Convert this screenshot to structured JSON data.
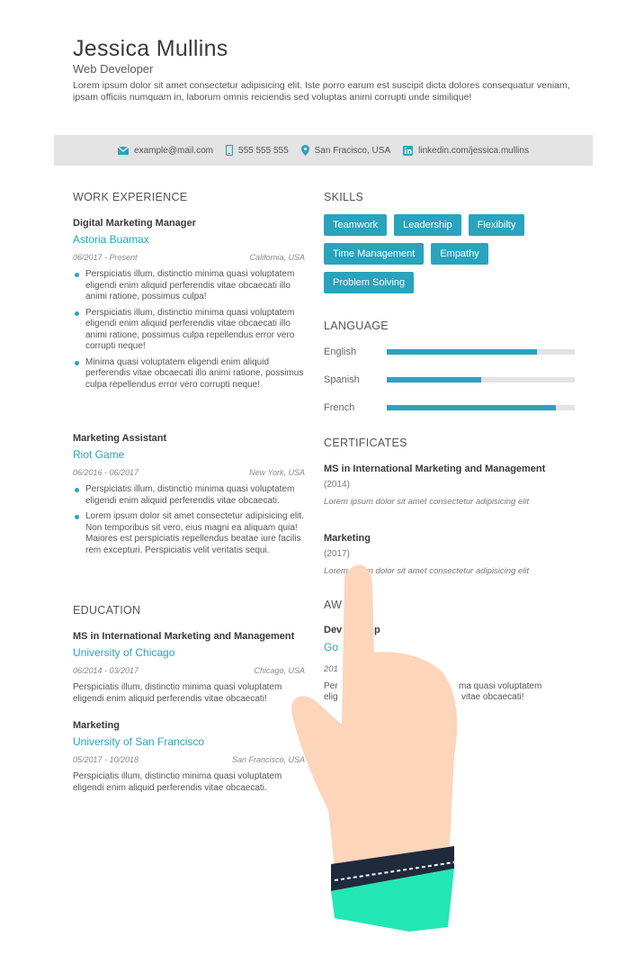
{
  "header": {
    "name": "Jessica Mullins",
    "role": "Web Developer",
    "summary": "Lorem ipsum dolor sit amet consectetur adipisicing elit. Iste porro earum est suscipit dicta dolores consequatur veniam, ipsam officiis numquam in, laborum omnis reiciendis sed voluptas animi corrupti unde similique!"
  },
  "contact": {
    "email": "example@mail.com",
    "phone": "555 555 555",
    "location": "San Fracisco, USA",
    "linkedin": "linkedin.com/jessica.mullins",
    "icons": [
      "envelope-icon",
      "phone-icon",
      "location-pin-icon",
      "linkedin-icon"
    ]
  },
  "work": {
    "heading": "WORK EXPERIENCE",
    "jobs": [
      {
        "title": "Digital Marketing Manager",
        "company": "Astoria Buamax",
        "dates": "06/2017 - Present",
        "location": "California, USA",
        "bullets": [
          "Perspiciatis illum, distinctio minima quasi voluptatem eligendi enim aliquid perferendis vitae obcaecati illo animi ratione, possimus culpa!",
          "Perspiciatis illum, distinctio minima quasi voluptatem eligendi enim aliquid perferendis vitae obcaecati illo animi ratione, possimus culpa repellendus error vero corrupti neque!",
          "Minima quasi voluptatem eligendi enim aliquid perferendis vitae obcaecati illo animi ratione, possimus culpa repellendus error vero corrupti neque!"
        ]
      },
      {
        "title": "Marketing Assistant",
        "company": "Riot Game",
        "dates": "06/2016 - 06/2017",
        "location": "New York, USA",
        "bullets": [
          "Perspiciatis illum, distinctio minima quasi voluptatem eligendi enim aliquid perferendis vitae obcaecati.",
          "Lorem ipsum dolor sit amet consectetur adipisicing elit. Non temporibus sit vero, eius magni ea aliquam quia! Maiores est perspiciatis repellendus beatae iure facilis rem excepturi. Perspiciatis velit veritatis sequi."
        ]
      }
    ]
  },
  "education": {
    "heading": "EDUCATION",
    "items": [
      {
        "degree": "MS in International Marketing and Management",
        "school": "University of Chicago",
        "dates": "06/2014 - 03/2017",
        "location": "Chicago, USA",
        "desc": "Perspiciatis illum, distinctio minima quasi voluptatem eligendi enim aliquid perferendis vitae obcaecati!"
      },
      {
        "degree": "Marketing",
        "school": "University of San Francisco",
        "dates": "05/2017 - 10/2018",
        "location": "San Francisco, USA",
        "desc": "Perspiciatis illum, distinctio minima quasi voluptatem eligendi enim aliquid perferendis vitae obcaecati."
      }
    ]
  },
  "skills": {
    "heading": "SKILLS",
    "items": [
      "Teamwork",
      "Leadership",
      "Flexibilty",
      "Time Management",
      "Empathy",
      "Problem Solving"
    ],
    "accent_color": "#2aa3bd"
  },
  "language": {
    "heading": "LANGUAGE",
    "items": [
      {
        "name": "English",
        "level": 0.8
      },
      {
        "name": "Spanish",
        "level": 0.5
      },
      {
        "name": "French",
        "level": 0.9
      }
    ]
  },
  "certificates": {
    "heading": "CERTIFICATES",
    "items": [
      {
        "title": "MS in International Marketing and Management",
        "year": "(2014)",
        "desc": "Lorem ipsum dolor sit amet consectetur adipisicing elit"
      },
      {
        "title": "Marketing",
        "year": "(2017)",
        "desc": "Lorem ipsum dolor sit amet consectetur adipisicing elit"
      }
    ]
  },
  "awards": {
    "heading": "AW",
    "title": "Dev",
    "title_tail": "p",
    "org": "Go",
    "year": "201",
    "desc_left": "Per",
    "desc_left2": "elig",
    "desc_right": "ma quasi voluptatem",
    "desc_right2": "vitae obcaecati!"
  }
}
